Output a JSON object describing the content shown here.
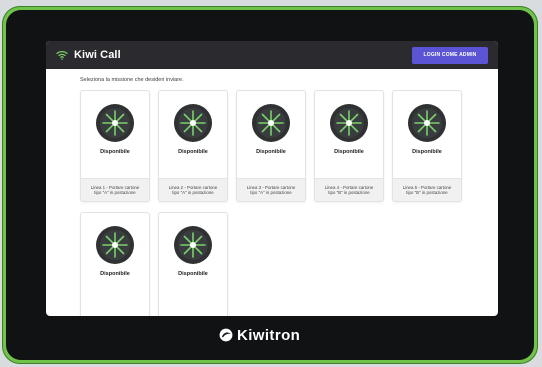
{
  "app": {
    "title": "Kiwi Call",
    "admin_button": "LOGIN COME ADMIN",
    "instruction": "Seleziona la missione che desideri inviare."
  },
  "missions": [
    {
      "status": "Disponibile",
      "label": "Linea 1 - Portare cartone tipo \"A\" in postazione"
    },
    {
      "status": "Disponibile",
      "label": "Linea 2 - Portare cartone tipo \"A\" in postazione"
    },
    {
      "status": "Disponibile",
      "label": "Linea 3 - Portare cartone tipo \"A\" in postazione"
    },
    {
      "status": "Disponibile",
      "label": "Linea 4 - Portare cartone tipo \"B\" in postazione"
    },
    {
      "status": "Disponibile",
      "label": "Linea 5 - Portare cartone tipo \"B\" in postazione"
    },
    {
      "status": "Disponibile",
      "label": ""
    },
    {
      "status": "Disponibile",
      "label": ""
    }
  ],
  "brand": {
    "logo_text": "Kiwitron"
  },
  "colors": {
    "frame_accent": "#6fc24a",
    "appbar": "#2b2b2f",
    "button": "#5b55d6",
    "robot_ring": "#2f3132",
    "robot_spokes": "#7ad06a"
  },
  "icons": {
    "wifi": "wifi-icon",
    "robot": "robot-icon",
    "logo": "kiwitron-logo-icon"
  }
}
